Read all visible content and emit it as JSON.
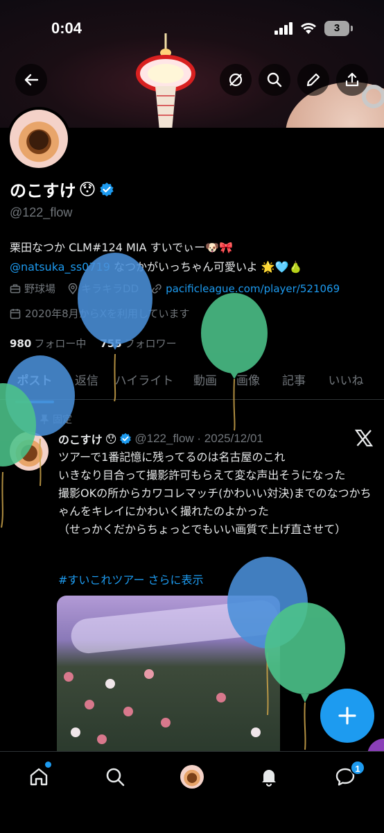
{
  "status_bar": {
    "time": "0:04",
    "battery": "3"
  },
  "header": {
    "buttons": [
      "back-icon",
      "mute-icon",
      "search-icon",
      "edit-icon",
      "share-icon"
    ]
  },
  "profile": {
    "name": "のこすけ",
    "handle": "@122_flow",
    "bio_line1": "栗田なつか CLM#124 MIA すいでぃー🐶🎀",
    "bio_mention": "@natsuka_ss0719",
    "bio_line2_rest": " なつかがいっちゃん可愛いよ 🌟🩵🍐",
    "meta": {
      "category": "野球場",
      "location": "キラキラDD",
      "website": "pacificleague.com/player/521069"
    },
    "joined": "2020年8月からXを利用しています",
    "following_count": "980",
    "following_label": "フォロー中",
    "followers_count": "755",
    "followers_label": "フォロワー"
  },
  "tabs": [
    {
      "label": "ポスト",
      "active": true
    },
    {
      "label": "返信",
      "active": false
    },
    {
      "label": "ハイライト",
      "active": false
    },
    {
      "label": "動画",
      "active": false
    },
    {
      "label": "画像",
      "active": false
    },
    {
      "label": "記事",
      "active": false
    },
    {
      "label": "いいね",
      "active": false
    }
  ],
  "post": {
    "pinned_label": "固定",
    "author": "のこすけ",
    "meta": "@122_flow · 2025/12/01",
    "lines": [
      "ツアーで1番記憶に残ってるのは名古屋のこれ",
      "いきなり目合って撮影許可もらえて変な声出そうになった",
      "撮影OKの所からカワコレマッチ(かわいい対決)までのなつかちゃんをキレイにかわいく撮れたのよかった",
      "（せっかくだからちょっとでもいい画質で上げ直させて）"
    ],
    "hashtag": "#すいこれツアー",
    "show_more": "さらに表示"
  },
  "bottom_nav": {
    "items": [
      "home-icon",
      "search-icon",
      "profile-avatar",
      "notifications-icon",
      "messages-icon"
    ],
    "messages_badge": "1"
  },
  "colors": {
    "accent": "#1d9bf0",
    "muted": "#71767b",
    "text": "#e7e9ea",
    "balloon_blue": "#4a90d9",
    "balloon_green": "#4cc38a"
  }
}
